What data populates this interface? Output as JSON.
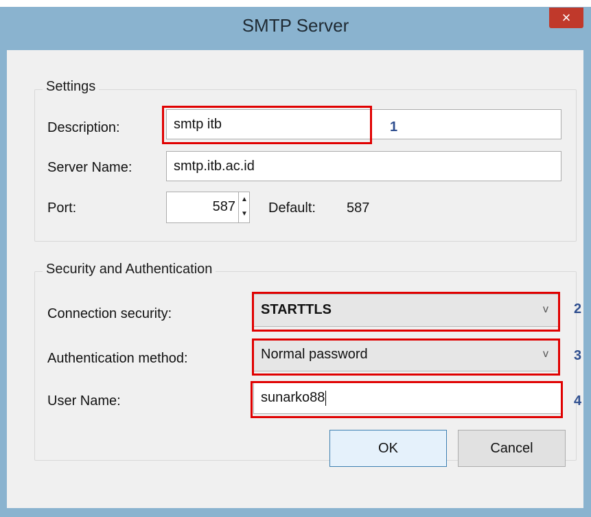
{
  "window": {
    "title": "SMTP Server",
    "close_label": "×"
  },
  "settings": {
    "group_title": "Settings",
    "description_label": "Description:",
    "description_value": "smtp itb",
    "server_name_label": "Server Name:",
    "server_name_value": "smtp.itb.ac.id",
    "port_label": "Port:",
    "port_value": "587",
    "default_label": "Default:",
    "default_value": "587"
  },
  "security": {
    "group_title": "Security and Authentication",
    "connection_label": "Connection security:",
    "connection_value": "STARTTLS",
    "auth_label": "Authentication method:",
    "auth_value": "Normal password",
    "username_label": "User Name:",
    "username_value": "sunarko88"
  },
  "annotations": {
    "n1": "1",
    "n2": "2",
    "n3": "3",
    "n4": "4",
    "highlight_color": "#e00000",
    "number_color": "#2f4f8f"
  },
  "buttons": {
    "ok": "OK",
    "cancel": "Cancel"
  },
  "icons": {
    "spin_up": "▲",
    "spin_down": "▼",
    "dropdown": "v"
  }
}
